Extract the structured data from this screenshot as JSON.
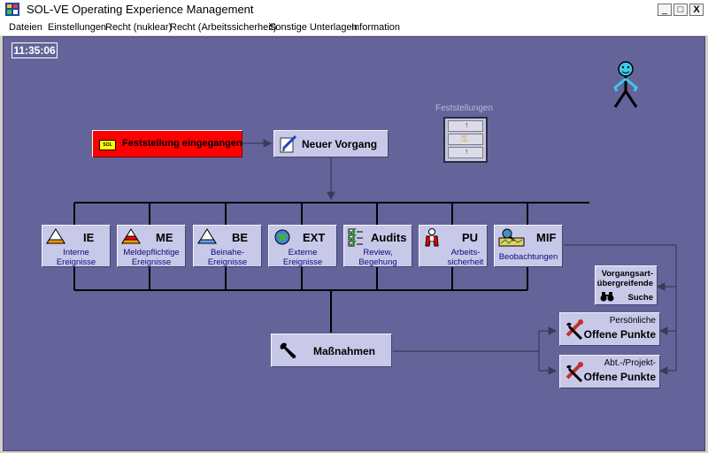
{
  "window": {
    "title": "SOL-VE Operating Experience Management",
    "minimize": "_",
    "maximize": "□",
    "close": "X"
  },
  "menu": [
    "Dateien",
    "Einstellungen",
    "Recht (nuklear)",
    "Recht (Arbeitssicherheit)",
    "Sonstige Unterlagen",
    "Information"
  ],
  "clock": "11:35:06",
  "cabinet_label": "Feststellungen",
  "red_button": {
    "label": "Feststellung eingegangen",
    "icon_text": "SOL"
  },
  "new_case": "Neuer Vorgang",
  "categories": [
    {
      "abbr": "IE",
      "line1": "Interne",
      "line2": "Ereignisse"
    },
    {
      "abbr": "ME",
      "line1": "Meldepflichtige",
      "line2": "Ereignisse"
    },
    {
      "abbr": "BE",
      "line1": "Beinahe-",
      "line2": "Ereignisse"
    },
    {
      "abbr": "EXT",
      "line1": "Externe",
      "line2": "Ereignisse"
    },
    {
      "abbr": "Audits",
      "line1": "Review,",
      "line2": "Begehung"
    },
    {
      "abbr": "PU",
      "line1": "Arbeits-",
      "line2": "sicherheit"
    },
    {
      "abbr": "MIF",
      "line1": "Beobachtungen",
      "line2": ""
    }
  ],
  "search": {
    "line1": "Vorgangsart-",
    "line2": "übergreifende",
    "line3": "Suche"
  },
  "measures": "Maßnahmen",
  "personal": {
    "top": "Persönliche",
    "bottom": "Offene Punkte"
  },
  "department": {
    "top": "Abt.-/Projekt-",
    "bottom": "Offene Punkte"
  },
  "colors": {
    "canvas": "#64649a",
    "button": "#c8c8e8",
    "alert": "#ff0000"
  }
}
